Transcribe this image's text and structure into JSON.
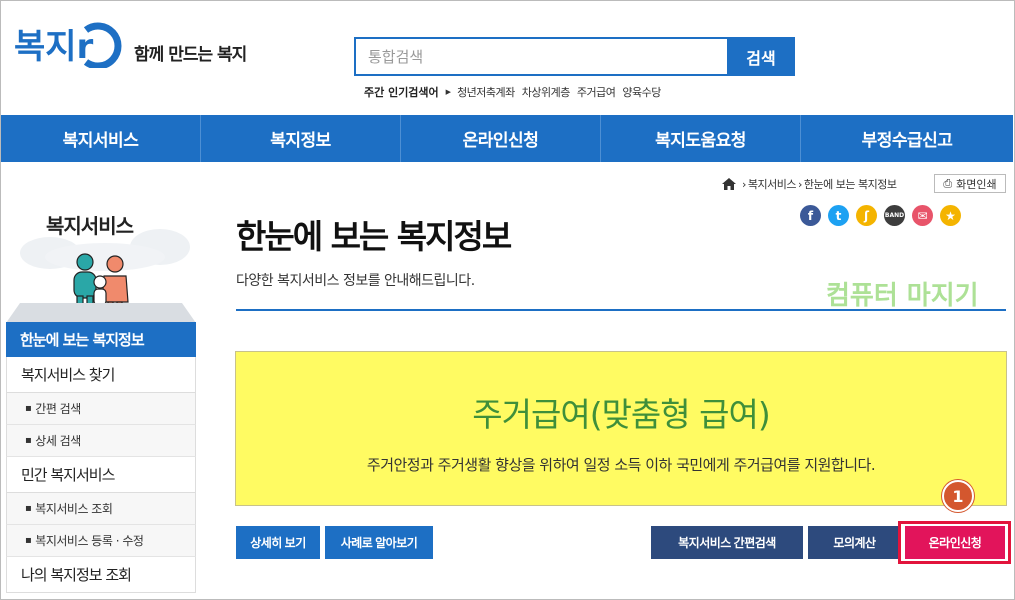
{
  "header": {
    "logo_text": "복지r",
    "slogan": "함께 만드는 복지",
    "search": {
      "placeholder": "통합검색",
      "button_label": "검색"
    },
    "popular": {
      "label": "주간 인기검색어",
      "keywords": [
        "청년저축계좌",
        "차상위계층",
        "주거급여",
        "양육수당"
      ]
    }
  },
  "nav": {
    "items": [
      "복지서비스",
      "복지정보",
      "온라인신청",
      "복지도움요청",
      "부정수급신고"
    ]
  },
  "breadcrumb": {
    "items": [
      "복지서비스",
      "한눈에 보는 복지정보"
    ],
    "print_label": "화면인쇄"
  },
  "share_icons": [
    "facebook-icon",
    "twitter-icon",
    "kakaostory-icon",
    "band-icon",
    "email-icon",
    "bookmark-icon"
  ],
  "sidebar": {
    "title": "복지서비스",
    "active": "한눈에 보는 복지정보",
    "groups": [
      {
        "label": "복지서비스 찾기",
        "subs": [
          "간편 검색",
          "상세 검색"
        ]
      },
      {
        "label": "민간 복지서비스",
        "subs": [
          "복지서비스 조회",
          "복지서비스 등록 · 수정"
        ]
      },
      {
        "label": "나의 복지정보 조회",
        "subs": []
      }
    ]
  },
  "main": {
    "title": "한눈에 보는 복지정보",
    "description": "다양한 복지서비스 정보를 안내해드립니다.",
    "deco_text": "컴퓨터 마지기",
    "service": {
      "title": "주거급여(맞춤형 급여)",
      "description": "주거안정과 주거생활 향상을 위하여 일정 소득 이하 국민에게 주거급여를 지원합니다."
    },
    "buttons": {
      "detail": "상세히 보기",
      "case": "사례로 알아보기",
      "quick_search": "복지서비스 간편검색",
      "calc": "모의계산",
      "apply": "온라인신청"
    },
    "step_badge": "1"
  },
  "colors": {
    "primary": "#1d6fc4",
    "dark_button": "#2d4a7d",
    "apply": "#e2145b",
    "highlight_border": "#e2143c",
    "yellow_box": "#fffb62",
    "service_title": "#3f8f3a"
  }
}
